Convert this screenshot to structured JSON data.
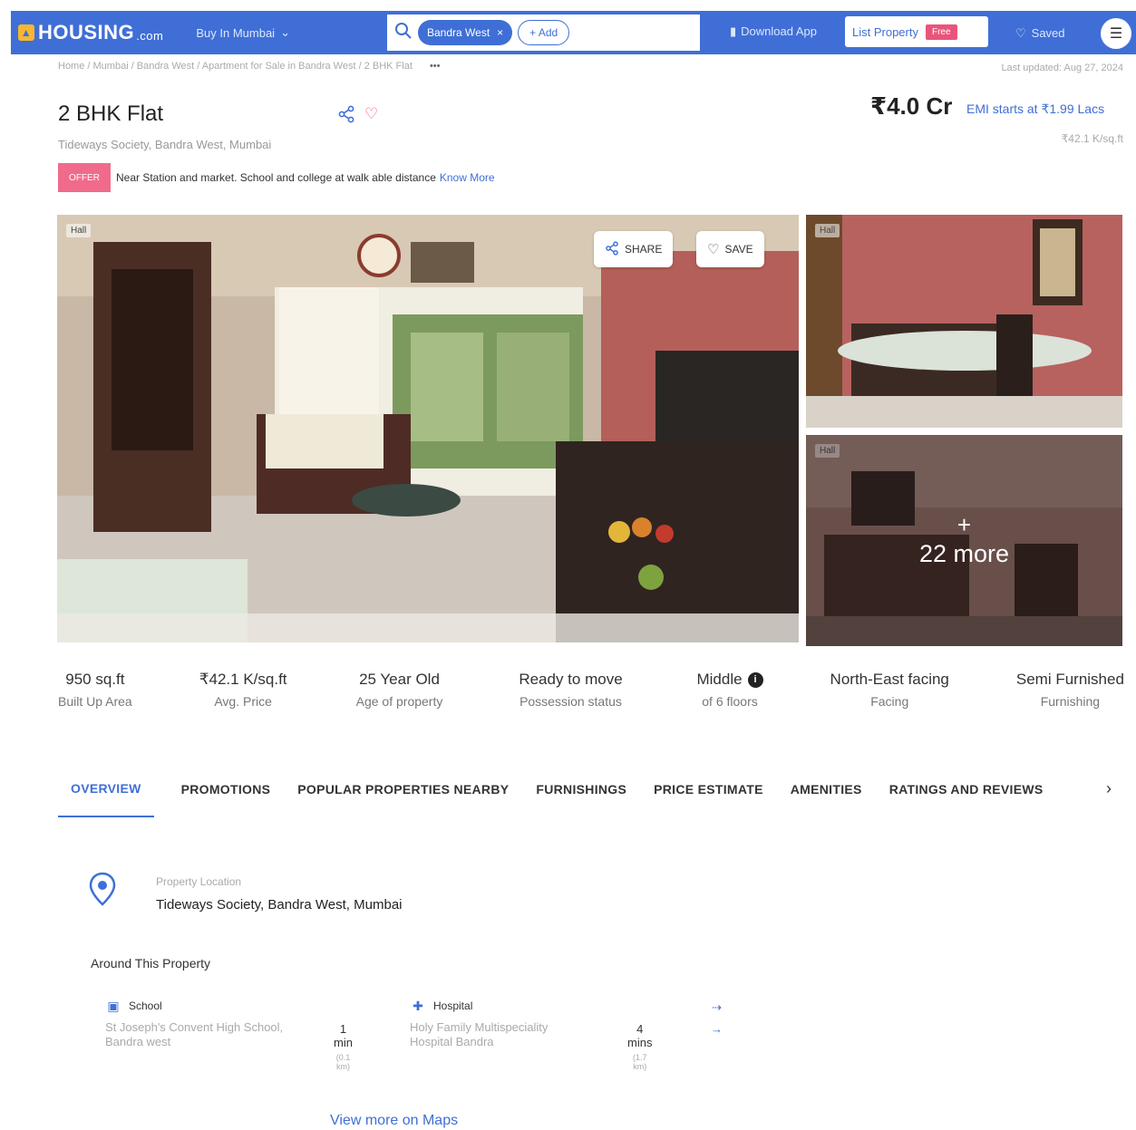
{
  "header": {
    "logo_text": "HOUSING",
    "logo_suffix": ".com",
    "city_menu": "Buy In Mumbai",
    "search_chip": "Bandra West",
    "add_chip": "+ Add",
    "download_app": "Download App",
    "list_property": "List Property",
    "free_badge": "Free",
    "saved": "Saved"
  },
  "breadcrumb": "Home / Mumbai / Bandra West / Apartment for Sale in Bandra West / 2 BHK Flat",
  "last_updated": "Last updated: Aug 27, 2024",
  "listing": {
    "title": "2 BHK Flat",
    "subtitle": "Tideways Society, Bandra West, Mumbai",
    "price": "₹4.0 Cr",
    "emi": "EMI starts at ₹1.99 Lacs",
    "price_per_sqft": "₹42.1 K/sq.ft"
  },
  "offer": {
    "badge": "OFFER",
    "text": "Near Station and market. School and college at walk able distance",
    "link": "Know More"
  },
  "gallery": {
    "main_tag": "Hall",
    "top_tag": "Hall",
    "bottom_tag": "Hall",
    "share_label": "SHARE",
    "save_label": "SAVE",
    "more_plus": "+",
    "more_label": "22 more"
  },
  "stats": [
    {
      "value": "950 sq.ft",
      "label": "Built Up Area"
    },
    {
      "value": "₹42.1 K/sq.ft",
      "label": "Avg. Price"
    },
    {
      "value": "25 Year Old",
      "label": "Age of property"
    },
    {
      "value": "Ready to move",
      "label": "Possession status"
    },
    {
      "value": "Middle",
      "label": "of 6 floors"
    },
    {
      "value": "North-East facing",
      "label": "Facing"
    },
    {
      "value": "Semi Furnished",
      "label": "Furnishing"
    }
  ],
  "tabs": [
    {
      "label": "OVERVIEW"
    },
    {
      "label": "PROMOTIONS"
    },
    {
      "label": "POPULAR PROPERTIES NEARBY"
    },
    {
      "label": "FURNISHINGS"
    },
    {
      "label": "PRICE ESTIMATE"
    },
    {
      "label": "AMENITIES"
    },
    {
      "label": "RATINGS AND REVIEWS"
    }
  ],
  "location": {
    "label": "Property Location",
    "value": "Tideways Society, Bandra West, Mumbai"
  },
  "around": {
    "title": "Around This Property",
    "places": [
      {
        "category": "School",
        "name": "St Joseph's Convent High School, Bandra west",
        "time": "1 min",
        "distance": "(0.1 km)"
      },
      {
        "category": "Hospital",
        "name": "Holy Family Multispeciality Hospital Bandra",
        "time": "4 mins",
        "distance": "(1.7 km)"
      }
    ]
  },
  "maps_link": "View more on Maps",
  "colors": {
    "brand_blue": "#3f6fd6",
    "offer_pink": "#f06b8b",
    "logo_yellow": "#f7b731"
  }
}
